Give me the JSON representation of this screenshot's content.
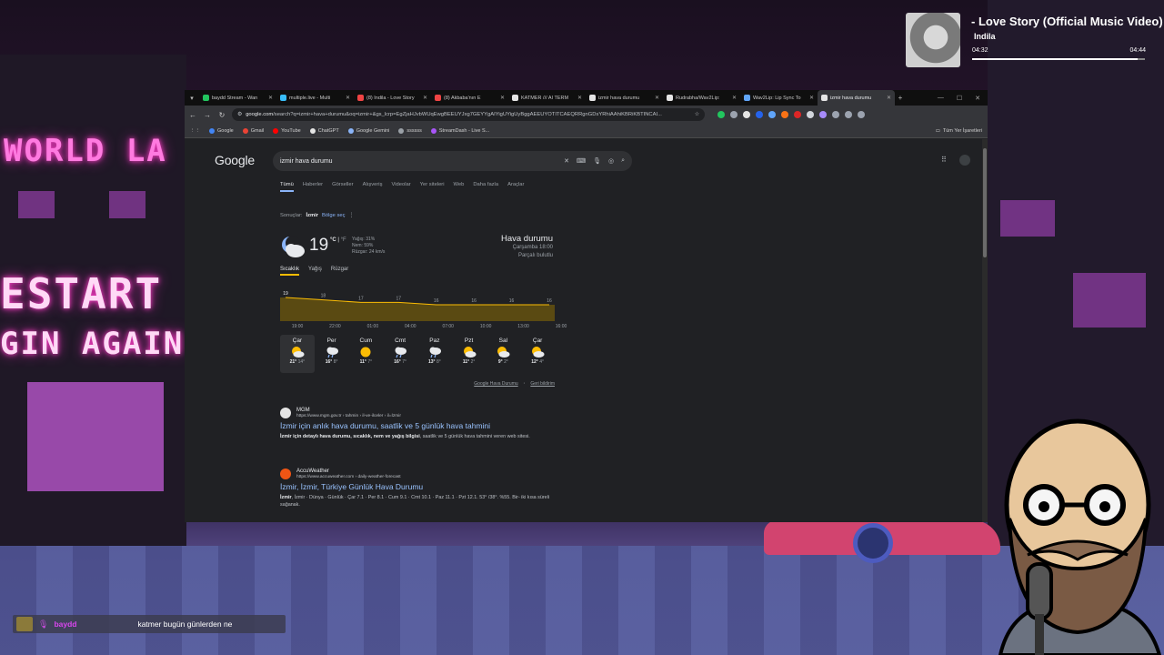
{
  "browser": {
    "tabs": [
      {
        "title": "baydd Stream - Wan",
        "color": "#22c55e",
        "active": false
      },
      {
        "title": "multiple.live - Multi",
        "color": "#38bdf8",
        "active": false
      },
      {
        "title": "(8) Indila - Love Story",
        "color": "#ef4444",
        "active": false
      },
      {
        "title": "(8) Akbaba'nın E",
        "color": "#ef4444",
        "active": false
      },
      {
        "title": "KATMER /// AI TERM",
        "color": "#e5e5e5",
        "active": false
      },
      {
        "title": "izmir hava durumu",
        "color": "#e5e5e5",
        "active": false
      },
      {
        "title": "Rudrabha/Wav2Lip:",
        "color": "#e5e5e5",
        "active": false
      },
      {
        "title": "Wav2Lip: Lip Sync To",
        "color": "#60a5fa",
        "active": false
      },
      {
        "title": "izmir hava durumu",
        "color": "#e5e5e5",
        "active": true
      }
    ],
    "url_host": "google.com",
    "url_rest": "/search?q=izmir+hava+durumu&oq=izmir+&gs_lcrp=EgZjaHJvbWUqEwgBEEUYJxg7GEYYgAIYigUYigUyBggAEEUYOTITCAEQRRgnGDsYRhiAAhiKBRiKBTINCAI...",
    "bookmarks": [
      {
        "label": "Google",
        "color": "#4285f4"
      },
      {
        "label": "Gmail",
        "color": "#ea4335"
      },
      {
        "label": "YouTube",
        "color": "#ff0000"
      },
      {
        "label": "ChatGPT",
        "color": "#e5e5e5"
      },
      {
        "label": "Google Gemini",
        "color": "#8ab4f8"
      },
      {
        "label": "ssssss",
        "color": "#9aa0a6"
      },
      {
        "label": "StreamDash - Live S...",
        "color": "#a855f7"
      }
    ],
    "all_bookmarks": "Tüm Yer İşaretleri"
  },
  "google": {
    "logo": "Google",
    "query": "izmir hava durumu",
    "tabs": [
      "Tümü",
      "Haberler",
      "Görseller",
      "Alışveriş",
      "Videolar",
      "Yer siteleri",
      "Web",
      "Daha fazla",
      "Araçlar"
    ],
    "results_prefix": "Sonuçlar:",
    "results_city": "İzmir",
    "choose_location": "Bölge seç"
  },
  "weather": {
    "temp": "19",
    "unit_c": "°C",
    "unit_f": "°F",
    "precip": "Yağış: 31%",
    "humidity": "Nem: 59%",
    "wind": "Rüzgar: 24 km/s",
    "title": "Hava durumu",
    "day_time": "Çarşamba 18:00",
    "condition": "Parçalı bulutlu",
    "tabs": [
      "Sıcaklık",
      "Yağış",
      "Rüzgar"
    ],
    "footer_source": "Google Hava Durumu",
    "footer_feedback": "Geri bildirim"
  },
  "chart_data": {
    "type": "area",
    "x": [
      "19:00",
      "22:00",
      "01:00",
      "04:00",
      "07:00",
      "10:00",
      "13:00",
      "16:00"
    ],
    "values": [
      19,
      18,
      17,
      17,
      16,
      16,
      16,
      16
    ],
    "labels": [
      "19",
      "18",
      "17",
      "17",
      "16",
      "16",
      "16",
      "16"
    ],
    "ylim": [
      10,
      22
    ],
    "fill_color": "#5a4a12",
    "line_color": "#fbbc04"
  },
  "forecast": [
    {
      "day": "Çar",
      "hi": "21°",
      "lo": "14°",
      "icon": "partly-sunny"
    },
    {
      "day": "Per",
      "hi": "16°",
      "lo": "8°",
      "icon": "rain-cloud"
    },
    {
      "day": "Cum",
      "hi": "11°",
      "lo": "7°",
      "icon": "sun"
    },
    {
      "day": "Cmt",
      "hi": "16°",
      "lo": "7°",
      "icon": "rain-cloud"
    },
    {
      "day": "Paz",
      "hi": "13°",
      "lo": "8°",
      "icon": "rain-cloud"
    },
    {
      "day": "Pzt",
      "hi": "11°",
      "lo": "2°",
      "icon": "partly-sunny"
    },
    {
      "day": "Sal",
      "hi": "9°",
      "lo": "2°",
      "icon": "partly-sunny"
    },
    {
      "day": "Çar",
      "hi": "12°",
      "lo": "4°",
      "icon": "partly-sunny"
    }
  ],
  "results": [
    {
      "site": "MGM",
      "url": "https://www.mgm.gov.tr › tahmin › il-ve-ilceler › il=İzmir",
      "title": "İzmir için anlık hava durumu, saatlik ve 5 günlük hava tahmini",
      "snippet_bold": "İzmir için detaylı hava durumu, sıcaklık, nem ve yağış bilgisi",
      "snippet_rest": ", saatlik ve 5 günlük hava tahmini veren web sitesi.",
      "color": "#e5e5e5"
    },
    {
      "site": "AccuWeather",
      "url": "https://www.accuweather.com › daily-weather-forecast",
      "title": "İzmir, İzmir, Türkiye Günlük Hava Durumu",
      "snippet_bold": "İzmir",
      "snippet_rest": ", İzmir · Dünya · Günlük · Çar 7.1 · Per 8.1 · Cum 9.1 · Cmt 10.1 · Paz 11.1 · Pzt 12.1. 53° /38°. %55. Bir- iki kısa süreli sağanak.",
      "color": "#f05514"
    }
  ],
  "now_playing": {
    "title": "- Love Story (Official Music Video)",
    "artist": "Indila",
    "current": "04:32",
    "duration": "04:44",
    "progress": 0.96
  },
  "chat": {
    "user": "baydd",
    "message": "katmer bugün günlerden ne"
  },
  "sign_texts": [
    "WORLD LA",
    "ESTART",
    "GIN AGAIN"
  ]
}
